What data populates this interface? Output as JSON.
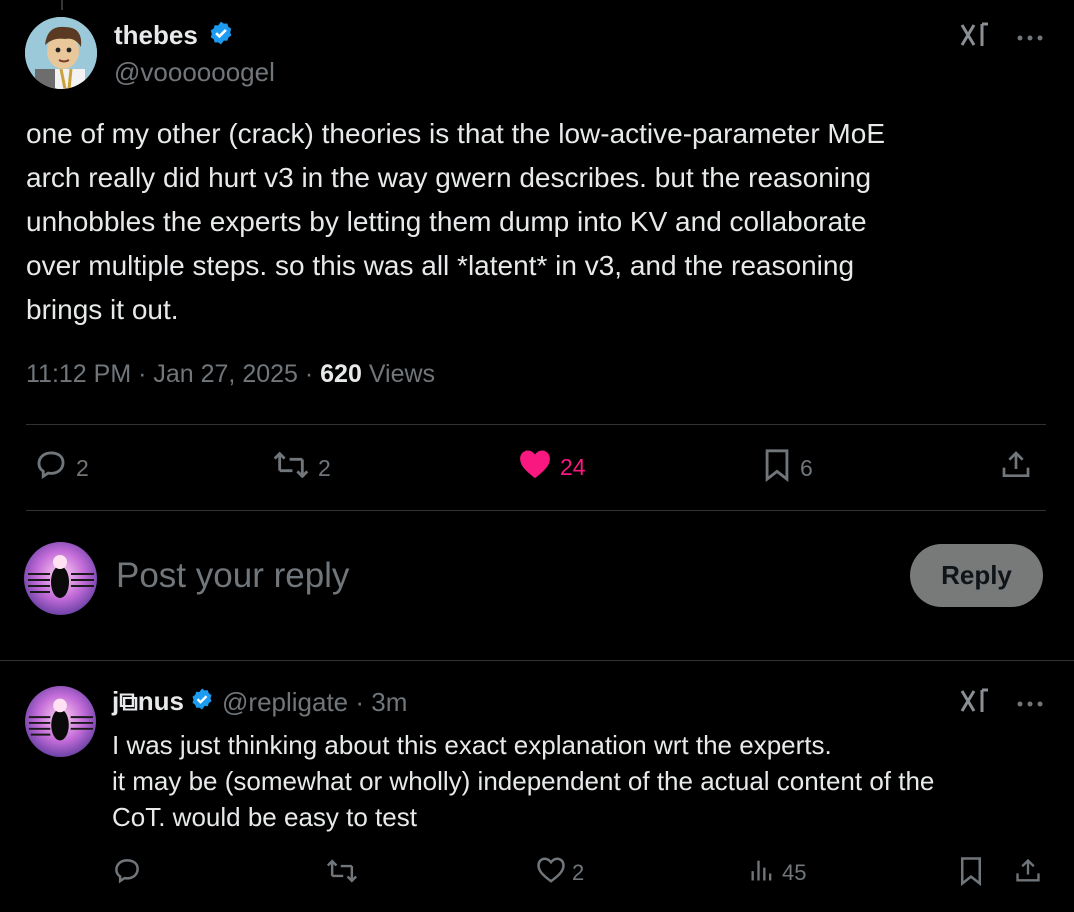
{
  "post": {
    "display_name": "thebes",
    "handle": "@voooooogel",
    "text": "one of my other (crack) theories is that the low-active-parameter MoE\narch really did hurt v3 in the way gwern describes. but the reasoning\nunhobbles the experts by letting them dump into KV and collaborate\nover multiple steps. so this was all *latent* in v3, and the reasoning\nbrings it out.",
    "time": "11:12 PM · Jan 27, 2025 · ",
    "views_count": "620",
    "views_label": " Views",
    "replies": "2",
    "reposts": "2",
    "likes": "24",
    "bookmarks": "6"
  },
  "composer": {
    "placeholder": "Post your reply",
    "button": "Reply"
  },
  "reply": {
    "display_name": "j⧉nus",
    "handle": "@repligate · 3m",
    "text": "I was just thinking about this exact explanation wrt the experts.\nit may be (somewhat or wholly) independent of the actual content of the\nCoT. would be easy to test",
    "likes": "2",
    "views": "45"
  },
  "colors": {
    "accent_like": "#f91880",
    "verified": "#1d9bf0",
    "muted": "#71767b"
  },
  "icons": [
    "verified-badge-icon",
    "grok-icon",
    "more-icon",
    "reply-icon",
    "repost-icon",
    "like-icon",
    "bookmark-icon",
    "share-icon",
    "views-icon"
  ]
}
